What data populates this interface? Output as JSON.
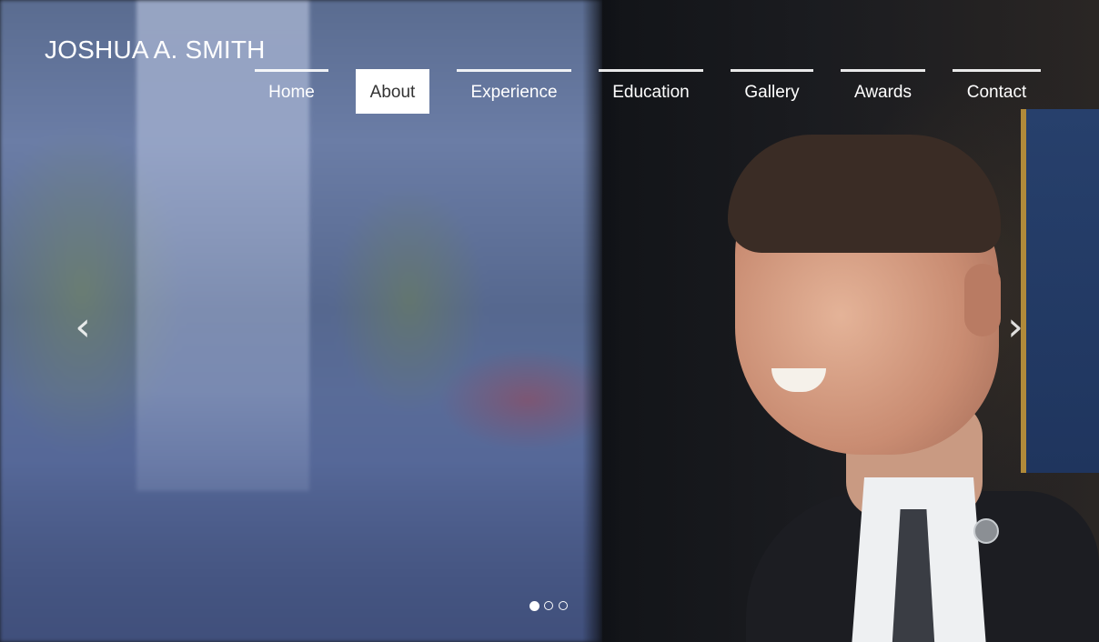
{
  "site": {
    "title": "JOSHUA A. SMITH"
  },
  "nav": {
    "active": "About",
    "items": [
      {
        "label": "Home"
      },
      {
        "label": "About"
      },
      {
        "label": "Experience"
      },
      {
        "label": "Education"
      },
      {
        "label": "Gallery"
      },
      {
        "label": "Awards"
      },
      {
        "label": "Contact"
      }
    ]
  },
  "carousel": {
    "prev_icon": "chevron-left-icon",
    "next_icon": "chevron-right-icon",
    "slide_count": 3,
    "active_slide": 1
  }
}
